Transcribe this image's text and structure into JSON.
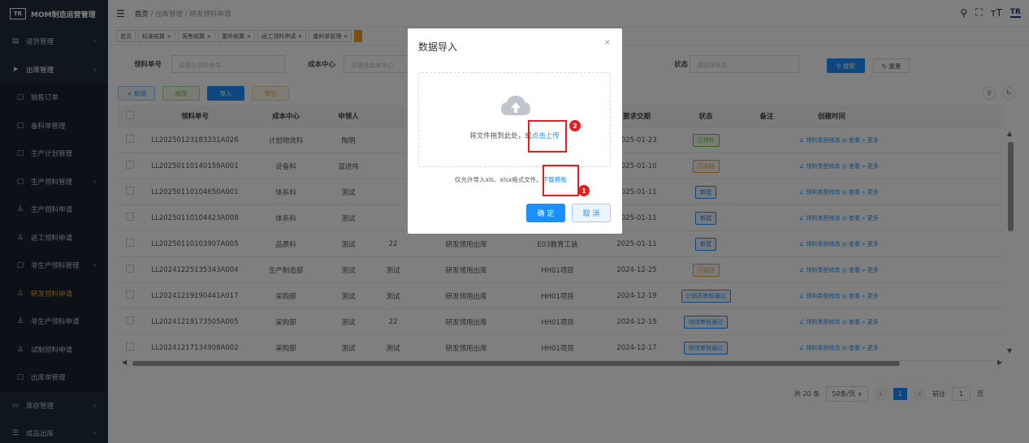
{
  "app": {
    "logo_text": "TR",
    "title": "MOM制造运营管理"
  },
  "sidebar": {
    "items": [
      {
        "label": "退货管理",
        "arrow": "∨"
      },
      {
        "label": "出库管理",
        "arrow": "∧"
      },
      {
        "label": "销售订单"
      },
      {
        "label": "备料单管理"
      },
      {
        "label": "生产计划管理"
      },
      {
        "label": "生产领料管理",
        "arrow": "∧"
      },
      {
        "label": "生产领料申请"
      },
      {
        "label": "返工领料申请"
      },
      {
        "label": "非生产领料管理",
        "arrow": "∧"
      },
      {
        "label": "研发领料申请"
      },
      {
        "label": "非生产领料申请"
      },
      {
        "label": "试制领料申请"
      },
      {
        "label": "出库单管理"
      },
      {
        "label": "库存管理",
        "arrow": "∨"
      },
      {
        "label": "成品出库",
        "arrow": "∨"
      }
    ]
  },
  "breadcrumb": {
    "home": "首页",
    "sep1": "/",
    "level1": "出库管理",
    "sep2": "/",
    "level2": "研发领料申请"
  },
  "tags": [
    "首页",
    "标准结算 ×",
    "客售结算 ×",
    "委外结算 ×",
    "返工领料申请 ×",
    "备料单管理 ×"
  ],
  "search": {
    "order_label": "领料单号",
    "order_placeholder": "请输入领料单号",
    "cost_label": "成本中心",
    "cost_placeholder": "请选择成本中心",
    "status_label": "状态",
    "status_placeholder": "请选择状态",
    "search_btn": "搜索",
    "reset_btn": "重置"
  },
  "toolbar": {
    "add": "+ 新增",
    "edit": "修改",
    "import": "导入",
    "export": "导出"
  },
  "table": {
    "headers": [
      "领料单号",
      "成本中心",
      "申领人",
      "",
      "",
      "",
      "要求交期",
      "状态",
      "备注",
      "创建时间"
    ],
    "rows": [
      {
        "no": "LL20250123183331A026",
        "center": "计划物流科",
        "person": "陶明",
        "c4": "",
        "c5": "",
        "c6": "",
        "date": "2025-01-23",
        "status": "已领料"
      },
      {
        "no": "LL20250110140159A001",
        "center": "设备科",
        "person": "温进伟",
        "c4": "",
        "c5": "",
        "c6": "",
        "date": "2025-01-10",
        "status": "已冻结"
      },
      {
        "no": "LL20250110104650A001",
        "center": "体系科",
        "person": "测试",
        "c4": "",
        "c5": "",
        "c6": "",
        "date": "2025-01-11",
        "status": "新建"
      },
      {
        "no": "LL20250110104423A008",
        "center": "体系科",
        "person": "测试",
        "c4": "",
        "c5": "",
        "c6": "",
        "date": "2025-01-11",
        "status": "新建"
      },
      {
        "no": "LL20250110103907A005",
        "center": "品质科",
        "person": "测试",
        "c4": "22",
        "c5": "研发领用出库",
        "c6": "E03教育工装",
        "date": "2025-01-11",
        "status": "新建"
      },
      {
        "no": "LL20241225135343A004",
        "center": "生产制造部",
        "person": "测试",
        "c4": "测试",
        "c5": "研发领用出库",
        "c6": "HH01项目",
        "date": "2024-12-25",
        "status": "已驳回"
      },
      {
        "no": "LL20241219190441A017",
        "center": "采购部",
        "person": "测试",
        "c4": "测试",
        "c5": "研发领用出库",
        "c6": "HH01项目",
        "date": "2024-12-19",
        "status": "计划员审核通过"
      },
      {
        "no": "LL20241219173505A005",
        "center": "采购部",
        "person": "测试",
        "c4": "22",
        "c5": "研发领用出库",
        "c6": "HH01项目",
        "date": "2024-12-19",
        "status": "物流审核通过"
      },
      {
        "no": "LL20241217134908A002",
        "center": "采购部",
        "person": "测试",
        "c4": "测试",
        "c5": "研发领用出库",
        "c6": "HH01项目",
        "date": "2024-12-17",
        "status": "物流审核通过"
      }
    ],
    "row_actions": "∠ 领料类型修改 ◎ 查看 » 更多"
  },
  "pagination": {
    "total": "共 20 条",
    "page_size": "50条/页",
    "current": "1",
    "goto_label": "前往",
    "goto_value": "1",
    "page_suffix": "页"
  },
  "dialog": {
    "title": "数据导入",
    "close": "×",
    "drop_text": "将文件拖到此处，或",
    "upload_link": "点击上传",
    "tip_text": "仅允许导入xls、xlsx格式文件。",
    "template_link": "下载模板",
    "confirm": "确 定",
    "cancel": "取 消",
    "badge1": "1",
    "badge2": "2"
  },
  "colors": {
    "accent": "#1890ff",
    "highlight": "#e02020",
    "sidebar": "#1f2d3d",
    "active": "#f0a020"
  }
}
